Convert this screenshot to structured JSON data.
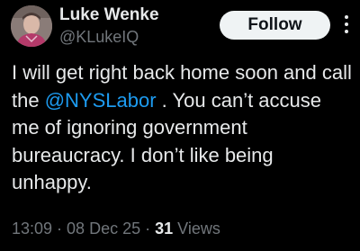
{
  "author": {
    "name": "Luke Wenke",
    "handle": "@KLukeIQ"
  },
  "follow_button": {
    "label": "Follow"
  },
  "tweet": {
    "before_mention": "I will get right back home soon and call the ",
    "mention": "@NYSLabor",
    "after_mention": " .  You can’t accuse me of ignoring government bureaucracy.  I don’t like being unhappy."
  },
  "meta": {
    "time": "13:09",
    "separator": " · ",
    "date": "08 Dec 25",
    "views_count": "31",
    "views_label": " Views"
  },
  "colors": {
    "background": "#000000",
    "text": "#e7e9ea",
    "secondary_text": "#71767b",
    "link": "#1d9bf0",
    "follow_button_bg": "#eff3f4"
  }
}
